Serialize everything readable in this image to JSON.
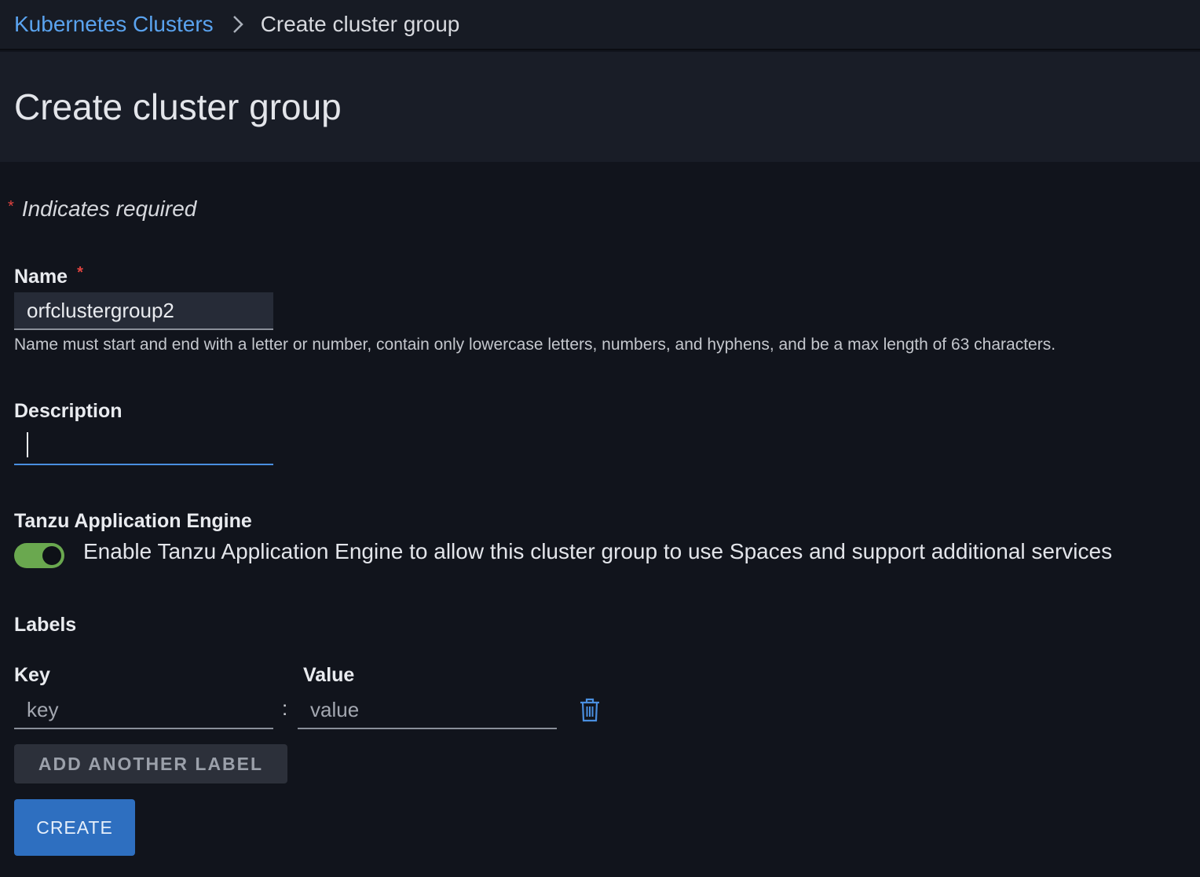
{
  "breadcrumb": {
    "parent": "Kubernetes Clusters",
    "current": "Create cluster group"
  },
  "header": {
    "title": "Create cluster group"
  },
  "form": {
    "required_note": "Indicates required",
    "name": {
      "label": "Name",
      "value": "orfclustergroup2",
      "helper": "Name must start and end with a letter or number, contain only lowercase letters, numbers, and hyphens, and be a max length of 63 characters."
    },
    "description": {
      "label": "Description",
      "value": ""
    },
    "tae": {
      "label": "Tanzu Application Engine",
      "enabled": true,
      "toggle_text": "Enable Tanzu Application Engine to allow this cluster group to use Spaces and support additional services"
    },
    "labels": {
      "title": "Labels",
      "key_label": "Key",
      "value_label": "Value",
      "key_placeholder": "key",
      "value_placeholder": "value",
      "separator": ":",
      "add_button": "ADD ANOTHER LABEL"
    },
    "create_button": "CREATE"
  },
  "colors": {
    "accent": "#2e6fc0",
    "link": "#5aa3ef",
    "toggle_on": "#6aa84f",
    "required": "#e0433f"
  }
}
